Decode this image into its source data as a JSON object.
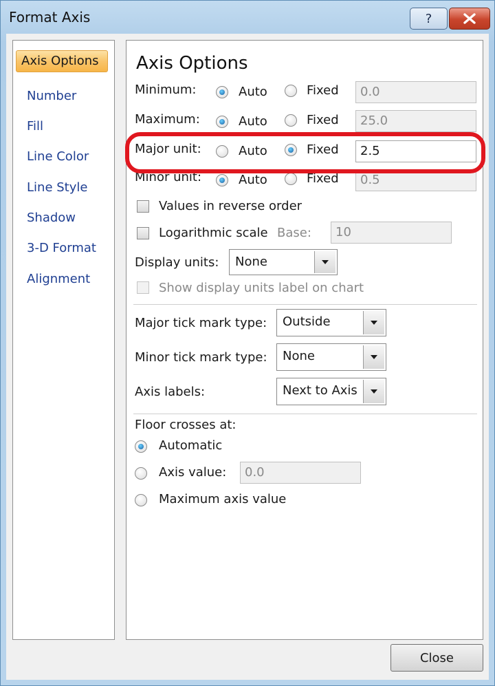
{
  "window": {
    "title": "Format Axis",
    "help_label": "?",
    "close_icon": "close-x-icon"
  },
  "sidebar": {
    "items": [
      {
        "label": "Axis Options",
        "selected": true
      },
      {
        "label": "Number"
      },
      {
        "label": "Fill"
      },
      {
        "label": "Line Color"
      },
      {
        "label": "Line Style"
      },
      {
        "label": "Shadow"
      },
      {
        "label": "3-D Format"
      },
      {
        "label": "Alignment"
      }
    ]
  },
  "panel": {
    "heading": "Axis Options",
    "rows": [
      {
        "label": "Minimum:",
        "auto": "Auto",
        "fixed": "Fixed",
        "selected": "auto",
        "value": "0.0"
      },
      {
        "label": "Maximum:",
        "auto": "Auto",
        "fixed": "Fixed",
        "selected": "auto",
        "value": "25.0"
      },
      {
        "label": "Major unit:",
        "auto": "Auto",
        "fixed": "Fixed",
        "selected": "fixed",
        "value": "2.5"
      },
      {
        "label": "Minor unit:",
        "auto": "Auto",
        "fixed": "Fixed",
        "selected": "auto",
        "value": "0.5"
      }
    ],
    "reverse_label": "Values in reverse order",
    "log_label": "Logarithmic scale",
    "base_label": "Base:",
    "base_value": "10",
    "display_units_label": "Display units:",
    "display_units_value": "None",
    "show_units_label": "Show display units label on chart",
    "major_tick_label": "Major tick mark type:",
    "major_tick_value": "Outside",
    "minor_tick_label": "Minor tick mark type:",
    "minor_tick_value": "None",
    "axis_labels_label": "Axis labels:",
    "axis_labels_value": "Next to Axis",
    "floor_label": "Floor crosses at:",
    "floor_automatic": "Automatic",
    "floor_axis_value": "Axis value:",
    "floor_axis_input": "0.0",
    "floor_max": "Maximum axis value"
  },
  "footer": {
    "close_label": "Close"
  },
  "colors": {
    "selected_nav": "#f9c56b",
    "link_text": "#1f3f92",
    "highlight": "#e0171f",
    "title_bar": "#b8d4ec"
  }
}
